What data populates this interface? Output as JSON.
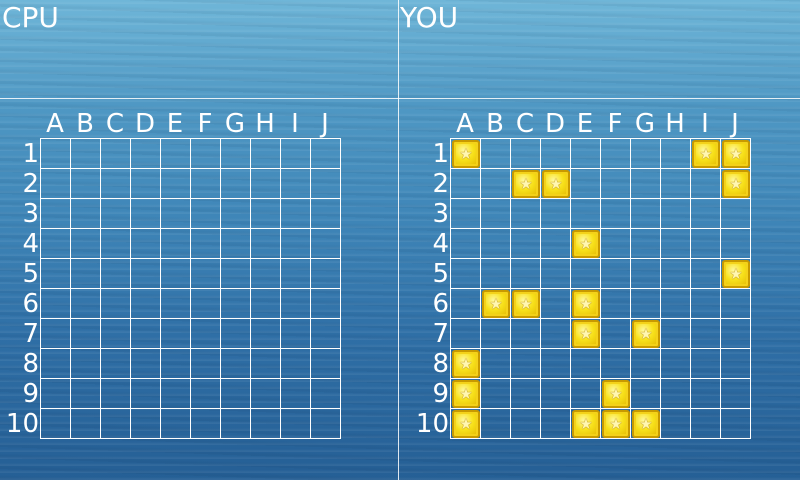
{
  "cpu": {
    "title": "CPU"
  },
  "you": {
    "title": "YOU"
  },
  "columns": [
    "A",
    "B",
    "C",
    "D",
    "E",
    "F",
    "G",
    "H",
    "I",
    "J"
  ],
  "rows": [
    "1",
    "2",
    "3",
    "4",
    "5",
    "6",
    "7",
    "8",
    "9",
    "10"
  ],
  "player_ships": [
    "A1",
    "I1",
    "J1",
    "C2",
    "D2",
    "J2",
    "E4",
    "J5",
    "B6",
    "C6",
    "E6",
    "E7",
    "G7",
    "A8",
    "A9",
    "F9",
    "A10",
    "E10",
    "F10",
    "G10"
  ],
  "ship_icon": "star-block-icon",
  "colors": {
    "ship": "#f8e21c",
    "grid": "#ffffff",
    "water": "#3f86b8"
  }
}
